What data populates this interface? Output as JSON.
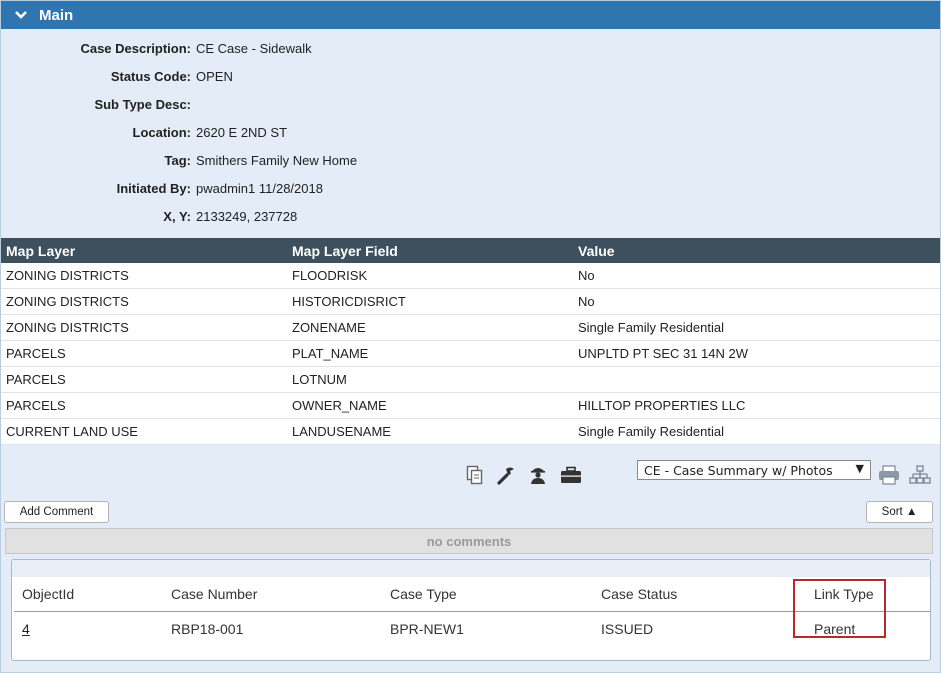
{
  "panel": {
    "title": "Main",
    "chevron_icon": "chevron-down-icon"
  },
  "fields": [
    {
      "label": "Case Description:",
      "value": "CE Case - Sidewalk"
    },
    {
      "label": "Status Code:",
      "value": "OPEN"
    },
    {
      "label": "Sub Type Desc:",
      "value": ""
    },
    {
      "label": "Location:",
      "value": "2620 E 2ND ST"
    },
    {
      "label": "Tag:",
      "value": "Smithers Family New Home"
    },
    {
      "label": "Initiated By:",
      "value": "pwadmin1 11/28/2018"
    },
    {
      "label": "X, Y:",
      "value": "2133249, 237728"
    }
  ],
  "map_table": {
    "headers": [
      "Map Layer",
      "Map Layer Field",
      "Value"
    ],
    "rows": [
      [
        "ZONING DISTRICTS",
        "FLOODRISK",
        "No"
      ],
      [
        "ZONING DISTRICTS",
        "HISTORICDISRICT",
        "No"
      ],
      [
        "ZONING DISTRICTS",
        "ZONENAME",
        "Single Family Residential"
      ],
      [
        "PARCELS",
        "PLAT_NAME",
        "UNPLTD PT SEC 31 14N 2W"
      ],
      [
        "PARCELS",
        "LOTNUM",
        ""
      ],
      [
        "PARCELS",
        "OWNER_NAME",
        "HILLTOP PROPERTIES LLC"
      ],
      [
        "CURRENT LAND USE",
        "LANDUSENAME",
        "Single Family Residential"
      ]
    ]
  },
  "toolbar": {
    "icons": [
      "copy-icon",
      "wrench-icon",
      "inspector-icon",
      "briefcase-icon",
      "print-icon",
      "hierarchy-icon"
    ],
    "report_selected": "CE - Case Summary w/ Photos"
  },
  "comments": {
    "add_label": "Add Comment",
    "sort_label": "Sort ▲",
    "empty_text": "no comments"
  },
  "links_table": {
    "headers": [
      "ObjectId",
      "Case Number",
      "Case Type",
      "Case Status",
      "Link Type"
    ],
    "rows": [
      [
        "4",
        "RBP18-001",
        "BPR-NEW1",
        "ISSUED",
        "Parent"
      ]
    ]
  },
  "colors": {
    "header_blue": "#2f76b1",
    "table_header": "#3e4f5e",
    "panel_bg": "#e4ecf7",
    "highlight_red": "#b8282d"
  }
}
